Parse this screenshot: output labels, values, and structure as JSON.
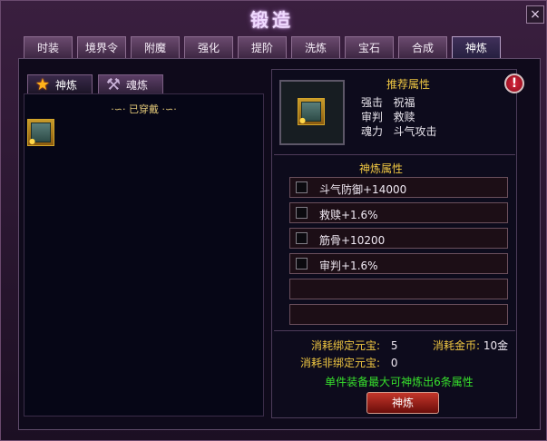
{
  "window": {
    "title": "锻造",
    "close_glyph": "×"
  },
  "tabs": [
    {
      "label": "时装",
      "active": false
    },
    {
      "label": "境界令",
      "active": false
    },
    {
      "label": "附魔",
      "active": false
    },
    {
      "label": "强化",
      "active": false
    },
    {
      "label": "提阶",
      "active": false
    },
    {
      "label": "洗炼",
      "active": false
    },
    {
      "label": "宝石",
      "active": false
    },
    {
      "label": "合成",
      "active": false
    },
    {
      "label": "神炼",
      "active": true
    }
  ],
  "left": {
    "subtabs": [
      {
        "label": "神炼",
        "icon": "star-icon",
        "active": true
      },
      {
        "label": "魂炼",
        "icon": "hammer-icon",
        "active": false
      }
    ],
    "equipped_label": "·∽· 已穿戴 ·∽·",
    "items": [
      {
        "name": "equipment-item",
        "icon": "armor-icon"
      }
    ]
  },
  "right": {
    "recommend": {
      "title": "推荐属性",
      "rows": [
        {
          "a": "强击",
          "b": "祝福"
        },
        {
          "a": "审判",
          "b": "救赎"
        },
        {
          "a": "魂力",
          "b": "斗气攻击"
        }
      ]
    },
    "attributes": {
      "title": "神炼属性",
      "rows": [
        {
          "text": "斗气防御+14000",
          "checked": false
        },
        {
          "text": "救赎+1.6%",
          "checked": false
        },
        {
          "text": "筋骨+10200",
          "checked": false
        },
        {
          "text": "审判+1.6%",
          "checked": false
        },
        {
          "text": "",
          "checked": false
        },
        {
          "text": "",
          "checked": false
        }
      ]
    },
    "costs": {
      "bound_label": "消耗绑定元宝:",
      "bound_value": "5",
      "gold_label": "消耗金币:",
      "gold_value": "10金",
      "unbound_label": "消耗非绑定元宝:",
      "unbound_value": "0"
    },
    "note": "单件装备最大可神炼出6条属性",
    "refine_button": "神炼"
  },
  "colors": {
    "gold_text": "#f0c742",
    "green_note": "#37e02c",
    "button_red": "#c4362a"
  }
}
